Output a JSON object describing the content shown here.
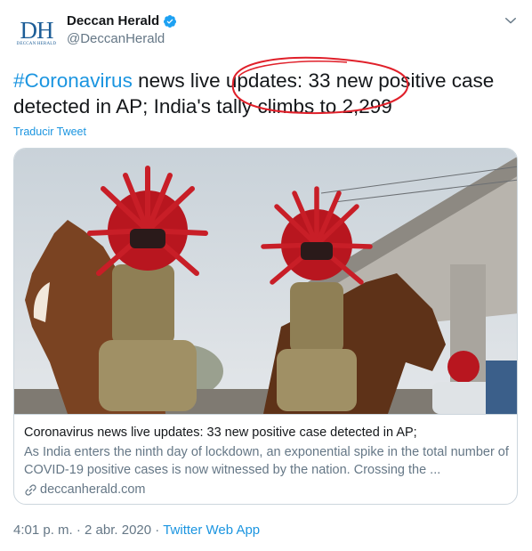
{
  "account": {
    "display_name": "Deccan Herald",
    "handle": "@DeccanHerald",
    "avatar_text": "DH",
    "avatar_subtext": "DECCAN HERALD",
    "verified_icon": "verified-badge-icon",
    "menu_icon": "chevron-down-icon"
  },
  "tweet": {
    "hashtag": "#Coronavirus",
    "text": " news live updates: 33 new positive case detected in AP; India's tally climbs to 2,299",
    "translate_label": "Traducir Tweet"
  },
  "card": {
    "title": "Coronavirus news live updates: 33 new positive case detected in AP;",
    "description": "As India enters the ninth day of lockdown, an exponential spike in the total number of COVID-19 positive cases is now witnessed by the nation. Crossing the ...",
    "domain": "deccanherald.com",
    "link_icon": "link-icon"
  },
  "meta": {
    "time": "4:01 p. m.",
    "separator": " · ",
    "date": "2 abr. 2020",
    "separator2": " · ",
    "app": "Twitter Web App"
  },
  "colors": {
    "accent": "#1b95e0",
    "muted": "#657786",
    "annotation": "#e0202a"
  }
}
